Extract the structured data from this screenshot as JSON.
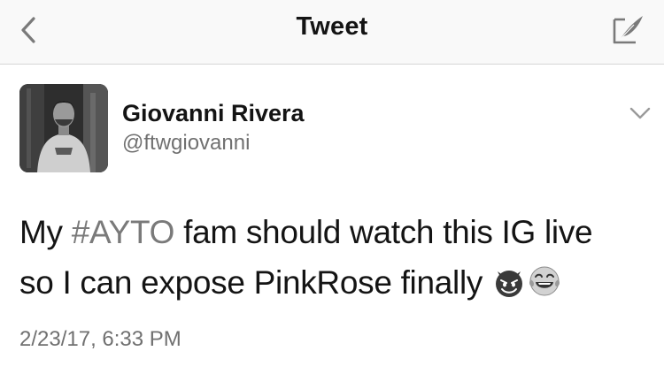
{
  "nav": {
    "title": "Tweet",
    "back_icon": "chevron-left-icon",
    "compose_icon": "compose-feather-icon"
  },
  "tweet": {
    "author": {
      "name": "Giovanni Rivera",
      "handle": "@ftwgiovanni"
    },
    "text_line1_before": "My ",
    "hashtag": "#AYTO",
    "text_line1_after": " fam should watch this IG live",
    "text_line2": "so I can expose PinkRose finally ",
    "emojis": [
      "smiling-imp-emoji",
      "tears-of-joy-emoji"
    ],
    "timestamp": "2/23/17, 6:33 PM"
  },
  "colors": {
    "text": "#141414",
    "secondary": "#707070",
    "hashtag": "#7a7a7a",
    "divider": "#d6d6d6"
  }
}
